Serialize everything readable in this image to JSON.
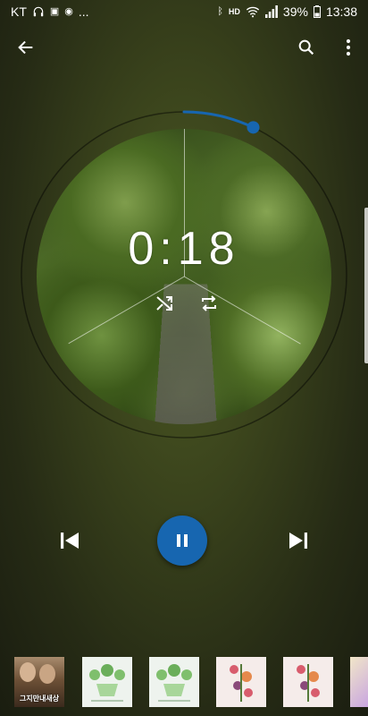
{
  "status_bar": {
    "carrier": "KT",
    "overflow": "...",
    "battery": "39%",
    "time": "13:38",
    "left_icons": [
      "headphones-icon",
      "notification-icon",
      "notification-icon"
    ],
    "right_icons": [
      "bluetooth-icon",
      "hd-voice-icon",
      "wifi-icon",
      "signal-icon",
      "battery-icon"
    ]
  },
  "toolbar": {
    "back_icon": "arrow-back-icon",
    "search_icon": "search-icon",
    "menu_icon": "more-vert-icon"
  },
  "player": {
    "time": "0:18",
    "progress_fraction": 0.07,
    "accent_color": "#1766b0",
    "shuffle_icon": "shuffle-icon",
    "repeat_icon": "repeat-icon"
  },
  "controls": {
    "prev_icon": "skip-previous-icon",
    "play_pause_icon": "pause-icon",
    "next_icon": "skip-next-icon"
  },
  "queue": {
    "items": [
      {
        "label": "그지만내새상",
        "style": "photo"
      },
      {
        "label": "",
        "style": "illustration-green"
      },
      {
        "label": "",
        "style": "illustration-green"
      },
      {
        "label": "",
        "style": "floral-pink"
      },
      {
        "label": "",
        "style": "floral-pink"
      },
      {
        "label": "",
        "style": "partial"
      }
    ]
  }
}
